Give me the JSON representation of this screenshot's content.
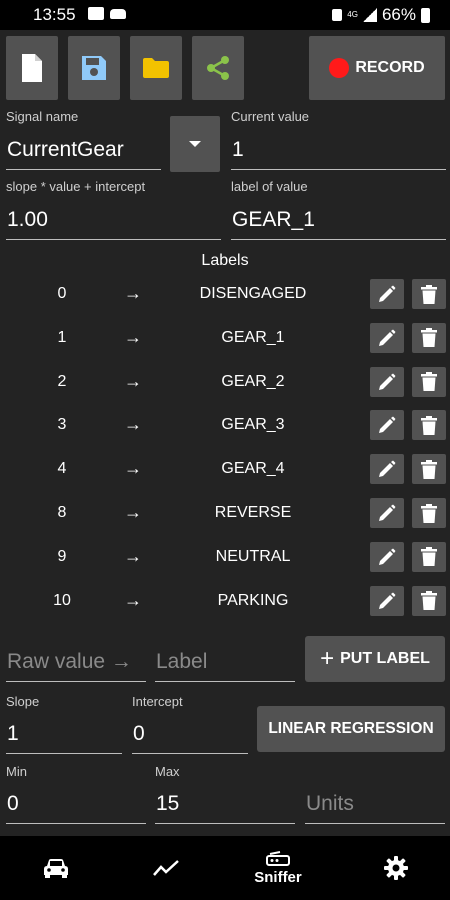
{
  "status_bar": {
    "time": "13:55",
    "battery": "66%",
    "network": "4G"
  },
  "toolbar": {
    "record_label": "RECORD",
    "colors": {
      "button_bg": "#525252",
      "folder": "#f2c200",
      "share": "#8bc34a",
      "save": "#90caf9",
      "record_dot": "#ff1a1a"
    }
  },
  "signal": {
    "name_label": "Signal name",
    "name_value": "CurrentGear",
    "current_label": "Current value",
    "current_value": "1",
    "formula_label": "slope * value + intercept",
    "formula_value": "1.00",
    "label_of_value_label": "label of value",
    "label_of_value": "GEAR_1"
  },
  "labels": {
    "title": "Labels",
    "arrow": "→",
    "rows": [
      {
        "raw": "0",
        "label": "DISENGAGED"
      },
      {
        "raw": "1",
        "label": "GEAR_1"
      },
      {
        "raw": "2",
        "label": "GEAR_2"
      },
      {
        "raw": "3",
        "label": "GEAR_3"
      },
      {
        "raw": "4",
        "label": "GEAR_4"
      },
      {
        "raw": "8",
        "label": "REVERSE"
      },
      {
        "raw": "9",
        "label": "NEUTRAL"
      },
      {
        "raw": "10",
        "label": "PARKING"
      }
    ]
  },
  "put_label": {
    "raw_placeholder": "Raw value →",
    "label_placeholder": "Label",
    "button_label": "PUT LABEL",
    "plus": "+"
  },
  "regression": {
    "slope_label": "Slope",
    "slope_value": "1",
    "intercept_label": "Intercept",
    "intercept_value": "0",
    "button_label": "LINEAR REGRESSION"
  },
  "range": {
    "min_label": "Min",
    "min_value": "0",
    "max_label": "Max",
    "max_value": "15",
    "units_placeholder": "Units"
  },
  "bottom_nav": {
    "items": [
      {
        "icon": "car-icon",
        "label": ""
      },
      {
        "icon": "chart-icon",
        "label": ""
      },
      {
        "icon": "sniffer-icon",
        "label": "Sniffer"
      },
      {
        "icon": "gear-icon",
        "label": ""
      }
    ]
  }
}
